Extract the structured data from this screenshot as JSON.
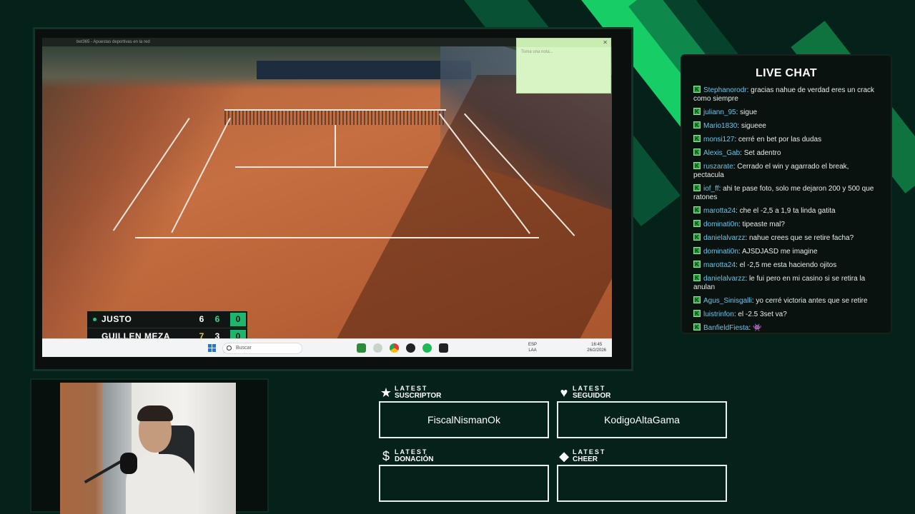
{
  "browser": {
    "tab_title": "bet365 - Apuestas deportivas en la red"
  },
  "note": {
    "placeholder": "Toma una nota..."
  },
  "scoreboard": {
    "players": [
      {
        "name": "JUSTO",
        "set1": "6",
        "set2": "6",
        "points": "0",
        "serving": true
      },
      {
        "name": "GUILLEN MEZA",
        "set1": "7",
        "set2": "3",
        "points": "0",
        "serving": false
      }
    ]
  },
  "taskbar": {
    "search_label": "Buscar",
    "lang": "ESP",
    "lang2": "LAA",
    "time": "16:45",
    "date": "26/2/2026"
  },
  "chat": {
    "title": "LIVE CHAT",
    "messages": [
      {
        "user": "Stephanorodr",
        "text": "gracias nahue de verdad eres un crack como siempre"
      },
      {
        "user": "juliann_95",
        "text": "sigue"
      },
      {
        "user": "Mario1830",
        "text": "sigueee"
      },
      {
        "user": "monsi127",
        "text": "cerré en bet por las dudas"
      },
      {
        "user": "Alexis_Gab",
        "text": "Set adentro"
      },
      {
        "user": "ruszarate",
        "text": "Cerrado el win y agarrado el break, pectacula"
      },
      {
        "user": "iof_ff",
        "text": "ahi te pase foto, solo me dejaron 200 y 500 que ratones"
      },
      {
        "user": "marotta24",
        "text": "che el -2,5 a 1,9 ta linda gatita"
      },
      {
        "user": "dominati0n",
        "text": "tipeaste mal?"
      },
      {
        "user": "danielalvarzz",
        "text": "nahue crees que se retire facha?"
      },
      {
        "user": "dominati0n",
        "text": "AJSDJASD me imagine"
      },
      {
        "user": "marotta24",
        "text": "el -2,5 me esta haciendo ojitos"
      },
      {
        "user": "danielalvarzz",
        "text": "le fui pero en mi casino si se retira la anulan"
      },
      {
        "user": "Agus_Sinisgalli",
        "text": "yo cerré victoria antes que se retire"
      },
      {
        "user": "luistrinfon",
        "text": "el -2.5 3set va?"
      },
      {
        "user": "BanfieldFiesta",
        "text": "👾"
      }
    ]
  },
  "latest": {
    "top_word": "LATEST",
    "suscriptor": {
      "label": "SUSCRIPTOR",
      "value": "FiscalNismanOk",
      "icon": "star-icon"
    },
    "seguidor": {
      "label": "SEGUIDOR",
      "value": "KodigoAltaGama",
      "icon": "heart-icon"
    },
    "donacion": {
      "label": "DONACIÓN",
      "value": "",
      "icon": "dollar-icon"
    },
    "cheer": {
      "label": "CHEER",
      "value": "",
      "icon": "diamond-icon"
    }
  },
  "colors": {
    "background": "#04211a",
    "accent": "#19e06f",
    "score_highlight": "#1fb56c",
    "username": "#6cc3e8"
  }
}
